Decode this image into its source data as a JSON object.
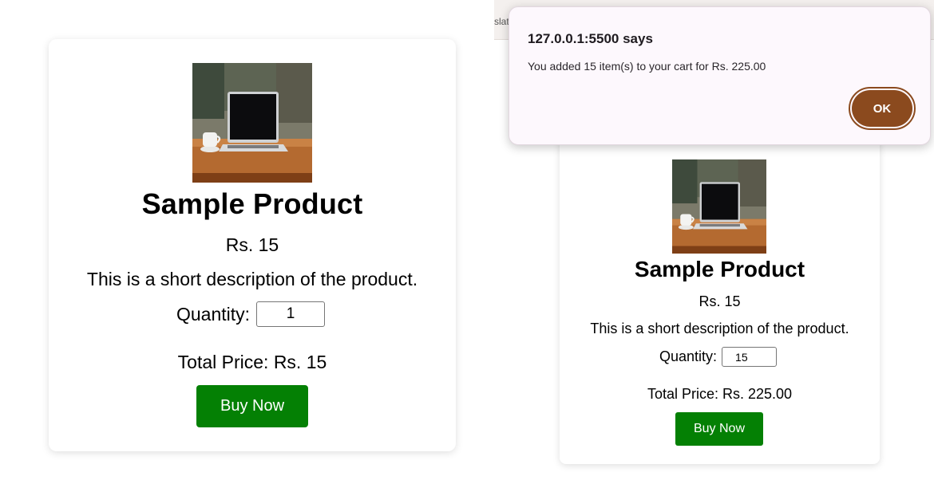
{
  "left_card": {
    "title": "Sample Product",
    "price": "Rs. 15",
    "description": "This is a short description of the product.",
    "quantity_label": "Quantity:",
    "quantity_value": "1",
    "total": "Total Price: Rs. 15",
    "buy_label": "Buy Now",
    "image_icon": "laptop-on-desk-photo"
  },
  "right_card": {
    "title": "Sample Product",
    "price": "Rs. 15",
    "description": "This is a short description of the product.",
    "quantity_label": "Quantity:",
    "quantity_value": "15",
    "total": "Total Price: Rs. 225.00",
    "buy_label": "Buy Now",
    "image_icon": "laptop-on-desk-photo"
  },
  "browser": {
    "tab_fragment": "slat"
  },
  "dialog": {
    "title": "127.0.0.1:5500 says",
    "message": "You added 15 item(s) to your cart for Rs. 225.00",
    "ok_label": "OK"
  },
  "colors": {
    "buy_button": "#048004",
    "dialog_accent": "#8b4a1e",
    "dialog_background": "#fdf8fd"
  }
}
